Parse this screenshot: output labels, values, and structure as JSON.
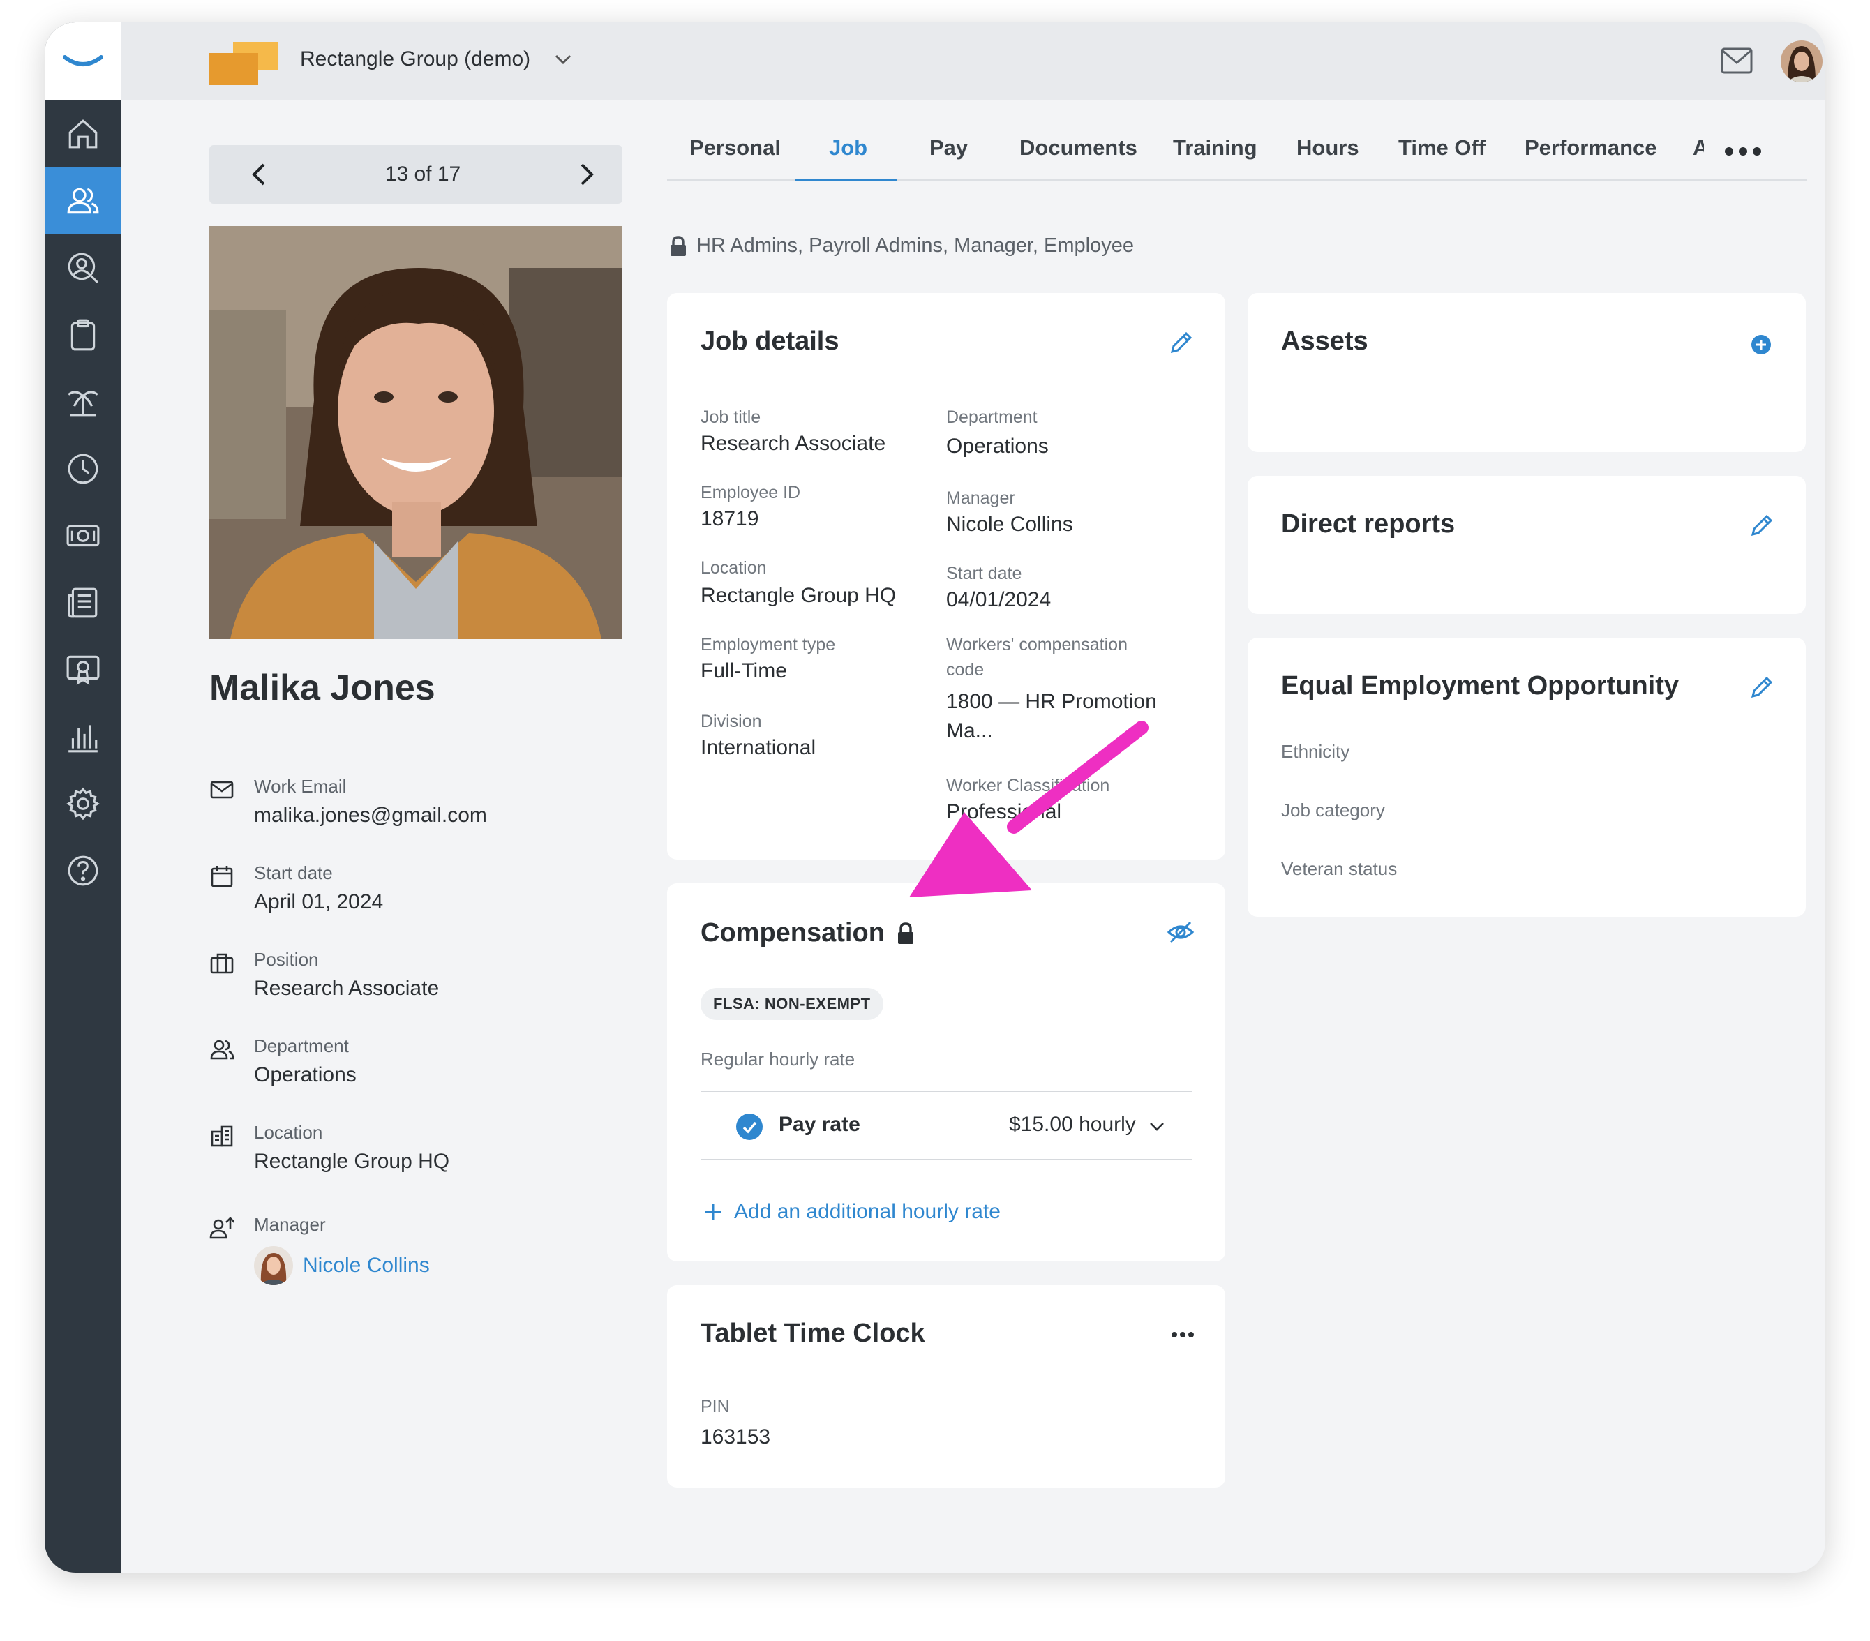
{
  "app": {
    "company_name": "Rectangle Group (demo)"
  },
  "sidebar": {
    "items": [
      {
        "name": "home-icon"
      },
      {
        "name": "people-icon",
        "active": true
      },
      {
        "name": "user-search-icon"
      },
      {
        "name": "clipboard-icon"
      },
      {
        "name": "palm-tree-icon"
      },
      {
        "name": "clock-icon"
      },
      {
        "name": "money-icon"
      },
      {
        "name": "news-icon"
      },
      {
        "name": "certificate-icon"
      },
      {
        "name": "bar-chart-icon"
      },
      {
        "name": "gear-icon"
      },
      {
        "name": "help-icon"
      }
    ]
  },
  "pager": {
    "text": "13 of 17"
  },
  "employee": {
    "name": "Malika Jones",
    "work_email_label": "Work Email",
    "work_email": "malika.jones@gmail.com",
    "start_date_label": "Start date",
    "start_date": "April 01, 2024",
    "position_label": "Position",
    "position": "Research Associate",
    "department_label": "Department",
    "department": "Operations",
    "location_label": "Location",
    "location": "Rectangle Group HQ",
    "manager_label": "Manager",
    "manager": "Nicole Collins"
  },
  "tabs": [
    "Personal",
    "Job",
    "Pay",
    "Documents",
    "Training",
    "Hours",
    "Time Off",
    "Performance",
    "A"
  ],
  "active_tab": "Job",
  "access_text": "HR Admins, Payroll Admins, Manager, Employee",
  "job_details": {
    "title": "Job details",
    "job_title_label": "Job title",
    "job_title": "Research Associate",
    "employee_id_label": "Employee ID",
    "employee_id": "18719",
    "location_label": "Location",
    "location": "Rectangle Group HQ",
    "employment_type_label": "Employment type",
    "employment_type": "Full-Time",
    "division_label": "Division",
    "division": "International",
    "department_label": "Department",
    "department": "Operations",
    "manager_label": "Manager",
    "manager": "Nicole Collins",
    "start_date_label": "Start date",
    "start_date": "04/01/2024",
    "workers_comp_label_1": "Workers' compensation",
    "workers_comp_label_2": "code",
    "workers_comp_1": "1800 — HR Promotion",
    "workers_comp_2": "Ma...",
    "worker_class_label": "Worker Classification",
    "worker_class": "Professional"
  },
  "compensation": {
    "title": "Compensation",
    "flsa": "FLSA: NON-EXEMPT",
    "rate_header": "Regular hourly rate",
    "pay_rate_label": "Pay rate",
    "pay_rate_value": "$15.00 hourly",
    "add_rate": "Add an additional hourly rate"
  },
  "tablet": {
    "title": "Tablet Time Clock",
    "pin_label": "PIN",
    "pin": "163153"
  },
  "assets": {
    "title": "Assets"
  },
  "direct_reports": {
    "title": "Direct reports"
  },
  "eeo": {
    "title": "Equal Employment Opportunity",
    "ethnicity": "Ethnicity",
    "job_category": "Job category",
    "veteran": "Veteran status"
  },
  "colors": {
    "accent": "#2f87cf",
    "sidebar": "#2f3841",
    "active_nav": "#3a8ed8",
    "annotation_arrow": "#ee2fc2"
  }
}
